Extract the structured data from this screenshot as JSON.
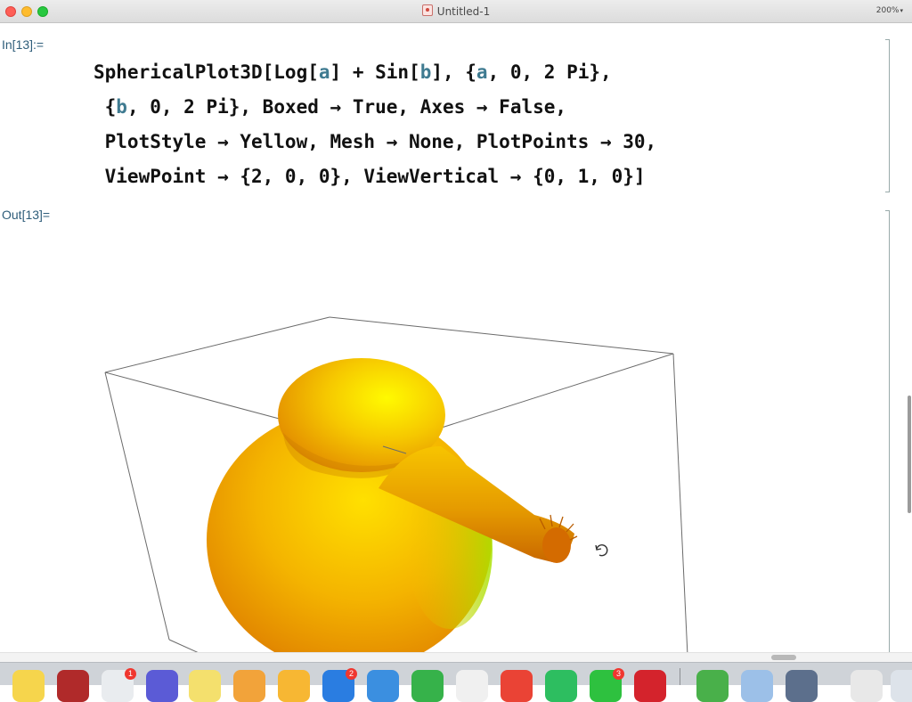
{
  "window": {
    "title": "Untitled-1",
    "zoom": "200%"
  },
  "notebook": {
    "input_label": "In[13]:=",
    "output_label": "Out[13]=",
    "code_lines": [
      [
        "SphericalPlot3D[Log[",
        {
          "v": "a"
        },
        "] + Sin[",
        {
          "v": "b"
        },
        "], {",
        {
          "v": "a"
        },
        ", 0, 2 Pi},"
      ],
      [
        " {",
        {
          "v": "b"
        },
        ", 0, 2 Pi}, Boxed → True, Axes → False,"
      ],
      [
        " PlotStyle → Yellow, Mesh → None, PlotPoints → 30,"
      ],
      [
        " ViewPoint → {2, 0, 0}, ViewVertical → {0, 1, 0}]"
      ]
    ]
  },
  "plot": {
    "style_color": "#ffd400",
    "box_color": "#6b6b6b",
    "rotate_cursor": "rotate-cursor-icon"
  },
  "dock": {
    "apps": [
      {
        "name": "notes-app-icon",
        "color": "#f6d54c"
      },
      {
        "name": "dictionary-app-icon",
        "color": "#b02a2a"
      },
      {
        "name": "calendar-app-icon",
        "color": "#e9ecef",
        "badge": "1"
      },
      {
        "name": "launchpad-app-icon",
        "color": "#5b5bd6"
      },
      {
        "name": "stickies-app-icon",
        "color": "#f4e06d"
      },
      {
        "name": "pages-app-icon",
        "color": "#f2a33a"
      },
      {
        "name": "messages-emoji-app-icon",
        "color": "#f7b733"
      },
      {
        "name": "mail-app-icon",
        "color": "#2a7de1",
        "badge": "2"
      },
      {
        "name": "keynote-app-icon",
        "color": "#3b8fe0"
      },
      {
        "name": "numbers-app-icon",
        "color": "#36b24a"
      },
      {
        "name": "mathematica-app-icon",
        "color": "#f0f0f0"
      },
      {
        "name": "chrome-app-icon",
        "color": "#ea4335"
      },
      {
        "name": "evernote-app-icon",
        "color": "#2dbe60"
      },
      {
        "name": "wechat-app-icon",
        "color": "#2ec13f",
        "badge": "3"
      },
      {
        "name": "wolfram-app-icon",
        "color": "#d4232c"
      },
      {
        "name": "script-app-icon",
        "color": "#49b04a"
      },
      {
        "name": "preview-app-icon",
        "color": "#9cc0e8"
      },
      {
        "name": "finder-app-icon",
        "color": "#5c6f8c"
      },
      {
        "name": "documents-app-icon",
        "color": "#e8e8e8"
      },
      {
        "name": "trash-app-icon",
        "color": "#dde3ea"
      }
    ]
  }
}
